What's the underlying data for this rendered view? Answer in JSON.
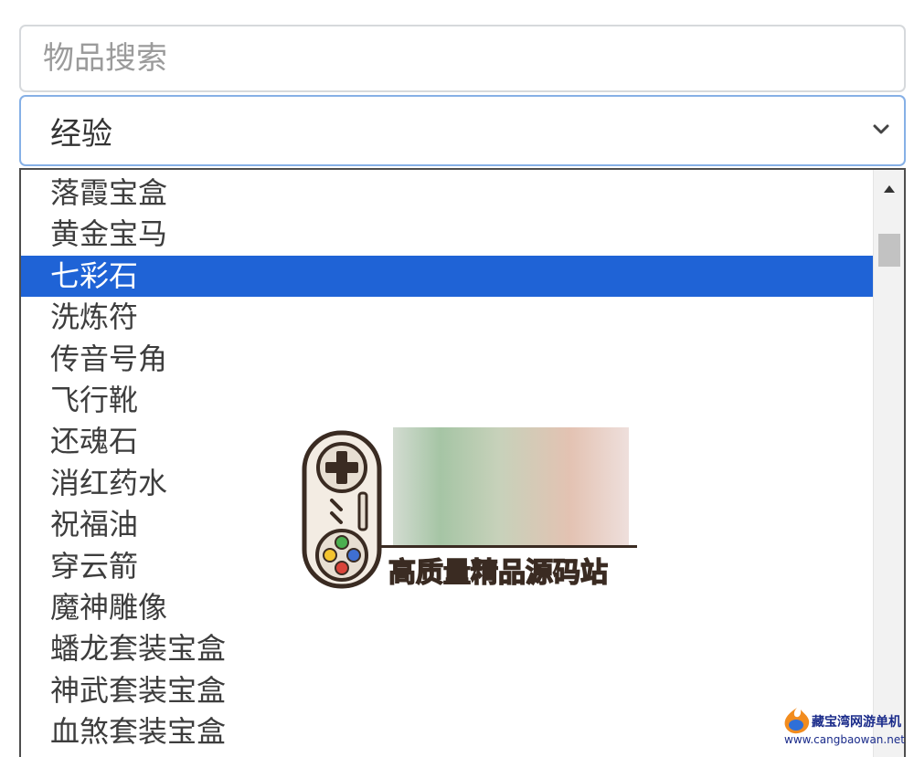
{
  "search": {
    "placeholder": "物品搜索",
    "value": ""
  },
  "category_select": {
    "selected": "经验"
  },
  "dropdown": {
    "options": [
      {
        "label": "落霞宝盒",
        "selected": false
      },
      {
        "label": "黄金宝马",
        "selected": false
      },
      {
        "label": "七彩石",
        "selected": true
      },
      {
        "label": "洗炼符",
        "selected": false
      },
      {
        "label": "传音号角",
        "selected": false
      },
      {
        "label": "飞行靴",
        "selected": false
      },
      {
        "label": "还魂石",
        "selected": false
      },
      {
        "label": "消红药水",
        "selected": false
      },
      {
        "label": "祝福油",
        "selected": false
      },
      {
        "label": "穿云箭",
        "selected": false
      },
      {
        "label": "魔神雕像",
        "selected": false
      },
      {
        "label": "蟠龙套装宝盒",
        "selected": false
      },
      {
        "label": "神武套装宝盒",
        "selected": false
      },
      {
        "label": "血煞套装宝盒",
        "selected": false
      }
    ],
    "scroll_position": 0.12
  },
  "colors": {
    "highlight": "#1f63d6",
    "focus_border": "#86b0e6"
  },
  "watermark": {
    "text": "高质量精品源码站"
  },
  "corner_logo": {
    "name": "藏宝湾网游单机",
    "url": "www.cangbaowan.net"
  }
}
